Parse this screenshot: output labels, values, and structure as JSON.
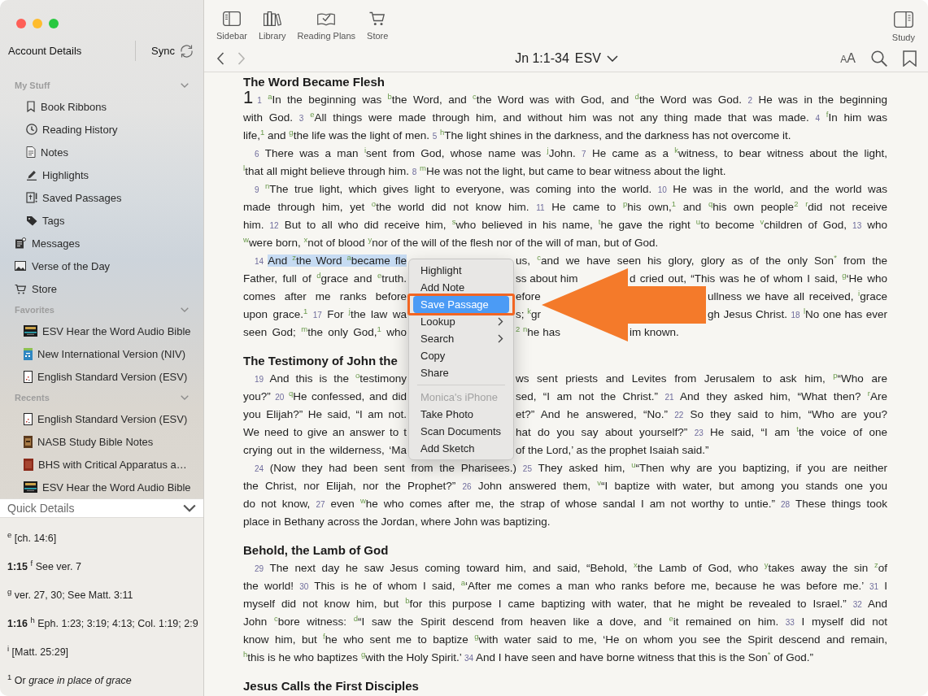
{
  "sidebar": {
    "account": "Account Details",
    "sync": "Sync",
    "groups": [
      {
        "kind": "section",
        "title": "My Stuff",
        "expanded": true,
        "children": [
          {
            "label": "Book Ribbons",
            "selected": false
          },
          {
            "label": "Reading History",
            "selected": false
          },
          {
            "label": "Notes",
            "selected": false
          },
          {
            "label": "Highlights",
            "selected": false
          },
          {
            "label": "Saved Passages",
            "selected": false
          },
          {
            "label": "Tags",
            "selected": false
          }
        ]
      },
      {
        "kind": "item",
        "label": "Messages",
        "selected": false
      },
      {
        "kind": "item",
        "label": "Verse of the Day",
        "selected": false
      },
      {
        "kind": "item",
        "label": "Store",
        "selected": false
      },
      {
        "kind": "section",
        "title": "Favorites",
        "expanded": true,
        "children": [
          {
            "label": "ESV Hear the Word Audio Bible",
            "selected": false
          },
          {
            "label": "New International Version (NIV)",
            "selected": false
          },
          {
            "label": "English Standard Version (ESV)",
            "selected": false
          }
        ]
      },
      {
        "kind": "section",
        "title": "Recents",
        "expanded": true,
        "children": [
          {
            "label": "English Standard Version (ESV)",
            "selected": false
          },
          {
            "label": "NASB Study Bible Notes",
            "selected": false
          },
          {
            "label": "BHS with Critical Apparatus a…",
            "selected": false
          },
          {
            "label": "ESV Hear the Word Audio Bible",
            "selected": false
          }
        ]
      }
    ]
  },
  "quick_details": {
    "title": "Quick Details",
    "expanded": true,
    "notes": [
      "$^{e}$ [ch. 14:6]",
      "**1:15** $^{f}$ See ver. 7",
      "$^{g}$ ver. 27, 30; See Matt. 3:11",
      "**1:16** $^{h}$ Eph. 1:23; 3:19; 4:13; Col. 1:19; 2:9",
      "$^{i}$ [Matt. 25:29]",
      "$^{1}$ Or *grace in place of grace*"
    ]
  },
  "toolbar": {
    "buttons": [
      {
        "label": "Sidebar"
      },
      {
        "label": "Library"
      },
      {
        "label": "Reading Plans"
      },
      {
        "label": "Store"
      }
    ],
    "study": {
      "label": "Study"
    }
  },
  "navigation": {
    "back": {
      "disabled": false
    },
    "forward": {
      "disabled": true
    },
    "reference": "Jn 1:1-34",
    "version": "ESV",
    "text_size": [
      "A",
      "A"
    ]
  },
  "reader": {
    "sections": [
      {
        "heading": "The Word Became Flesh",
        "paragraphs": [
          {
            "chapter": "1",
            "lines": [
              [
                [
                  {
                    "text": "$_{1}$ $^{a}$In the beginning was $^{b}$the Word, and $^{c}$the Word was with God, and $^{d}$the Word was God. $_{2}$ He was in the beginning",
                    "selected": false
                  }
                ]
              ],
              [
                [
                  {
                    "text": "with God. $_{3}$ $^{e}$All things were made through him, and without him was not any thing made that was made. $_{4}$ $^{f}$In him was",
                    "selected": false
                  }
                ]
              ],
              [
                [
                  {
                    "text": "life,$^{1}$ and $^{g}$the life was the light of men. $_{5}$ $^{h}$The light shines in the darkness, and the darkness has not overcome it.",
                    "selected": false
                  }
                ]
              ]
            ]
          },
          {
            "lines": [
              [
                [
                  {
                    "text": "$_{6}$ There was a man $^{i}$sent from God, whose name was $^{j}$John. $_{7}$ He came as a $^{k}$witness, to bear witness about the light,",
                    "selected": false
                  }
                ]
              ],
              [
                [
                  {
                    "text": "$^{l}$that all might believe through him. $_{8}$ $^{m}$He was not the light, but came to bear witness about the light.",
                    "selected": false
                  }
                ]
              ]
            ]
          },
          {
            "lines": [
              [
                [
                  {
                    "text": "$_{9}$ $^{n}$The true light, which gives light to everyone, was coming into the world. $_{10}$ He was in the world, and the world was",
                    "selected": false
                  }
                ]
              ],
              [
                [
                  {
                    "text": "made through him, yet $^{o}$the world did not know him. $_{11}$ He came to $^{p}$his own,$^{1}$ and $^{q}$his own people$^{2}$ $^{r}$did not receive",
                    "selected": false
                  }
                ]
              ],
              [
                [
                  {
                    "text": "him. $_{12}$ But to all who did receive him, $^{s}$who believed in his name, $^{t}$he gave the right $^{u}$to become $^{v}$children of God, $_{13}$ who",
                    "selected": false
                  }
                ]
              ],
              [
                [
                  {
                    "text": "$^{w}$were born, $^{x}$not of blood $^{y}$nor of the will of the flesh nor of the will of man, but of God.",
                    "selected": false
                  }
                ]
              ]
            ]
          },
          {
            "lines": [
              [
                [
                  {
                    "text": "$_{14}$ ",
                    "selected": false
                  },
                  {
                    "text": "And $^{z}$the Word $^{a}$became fle",
                    "selected": true
                  }
                ],
                [
                  {
                    "text": "us, $^{c}$and we have seen his glory, glory as of the only Son$^{*}$ from the",
                    "selected": false
                  }
                ]
              ],
              [
                [
                  {
                    "text": "Father, full of $^{d}$grace and $^{e}$truth.",
                    "selected": false
                  }
                ],
                [
                  {
                    "text": "ss about him",
                    "selected": false
                  }
                ],
                [
                  {
                    "text": "d cried out, “This was he of whom I said, $^{g}$‘He who",
                    "selected": false
                  }
                ]
              ],
              [
                [
                  {
                    "text": "comes after me ranks before",
                    "selected": false
                  }
                ],
                [
                  {
                    "text": "efore",
                    "selected": false
                  }
                ],
                [
                  {
                    "text": "ullness we have all received, $^{i}$grace",
                    "selected": false
                  }
                ]
              ],
              [
                [
                  {
                    "text": "upon grace.$^{1}$ $_{17}$ For $^{j}$the law wa",
                    "selected": false
                  }
                ],
                [
                  {
                    "text": "s; $^{k}$gr",
                    "selected": false
                  }
                ],
                [
                  {
                    "text": "gh Jesus Christ. $_{18}$ $^{l}$No one has ever",
                    "selected": false
                  }
                ]
              ],
              [
                [
                  {
                    "text": "seen God; $^{m}$the only God,$^{1}$ who",
                    "selected": false
                  }
                ],
                [
                  {
                    "text": "$^{2}$ $^{n}$he has",
                    "selected": false
                  }
                ],
                [
                  {
                    "text": "im known.",
                    "selected": false
                  }
                ]
              ]
            ]
          }
        ]
      },
      {
        "heading": "The Testimony of John the",
        "paragraphs": [
          {
            "lines": [
              [
                [
                  {
                    "text": "$_{19}$ And this is the $^{o}$testimony",
                    "selected": false
                  }
                ],
                [
                  {
                    "text": "ws sent priests and Levites from Jerusalem to ask him, $^{p}$“Who are",
                    "selected": false
                  }
                ]
              ],
              [
                [
                  {
                    "text": "you?” $_{20}$ $^{q}$He confessed, and did",
                    "selected": false
                  }
                ],
                [
                  {
                    "text": "sed, “I am not the Christ.” $_{21}$ And they asked him, “What then? $^{r}$Are",
                    "selected": false
                  }
                ]
              ],
              [
                [
                  {
                    "text": "you Elijah?” He said, “I am not.",
                    "selected": false
                  }
                ],
                [
                  {
                    "text": "et?” And he answered, “No.” $_{22}$ So they said to him, “Who are you?",
                    "selected": false
                  }
                ]
              ],
              [
                [
                  {
                    "text": "We need to give an answer to t",
                    "selected": false
                  }
                ],
                [
                  {
                    "text": "hat do you say about yourself?” $_{23}$ He said, “I am $^{t}$the voice of one",
                    "selected": false
                  }
                ]
              ],
              [
                [
                  {
                    "text": "crying out in the wilderness, ‘Ma",
                    "selected": false
                  }
                ],
                [
                  {
                    "text": "of the Lord,’ as the prophet Isaiah said.”",
                    "selected": false
                  }
                ]
              ]
            ]
          },
          {
            "lines": [
              [
                [
                  {
                    "text": "$_{24}$ (Now they had been sent from the Pharisees.) $_{25}$ They asked him, $^{u}$“Then why are you baptizing, if you are neither",
                    "selected": false
                  }
                ]
              ],
              [
                [
                  {
                    "text": "the Christ, nor Elijah, nor the Prophet?” $_{26}$ John answered them, $^{v}$“I baptize with water, but among you stands one you",
                    "selected": false
                  }
                ]
              ],
              [
                [
                  {
                    "text": "do not know, $_{27}$ even $^{w}$he who comes after me, the strap of whose sandal I am not worthy to untie.” $_{28}$ These things took",
                    "selected": false
                  }
                ]
              ],
              [
                [
                  {
                    "text": "place in Bethany across the Jordan, where John was baptizing.",
                    "selected": false
                  }
                ]
              ]
            ]
          }
        ]
      },
      {
        "heading": "Behold, the Lamb of God",
        "paragraphs": [
          {
            "lines": [
              [
                [
                  {
                    "text": "$_{29}$ The next day he saw Jesus coming toward him, and said, “Behold, $^{x}$the Lamb of God, who $^{y}$takes away the sin $^{z}$of",
                    "selected": false
                  }
                ]
              ],
              [
                [
                  {
                    "text": "the world! $_{30}$ This is he of whom I said, $^{a}$‘After me comes a man who ranks before me, because he was before me.’ $_{31}$ I",
                    "selected": false
                  }
                ]
              ],
              [
                [
                  {
                    "text": "myself did not know him, but $^{b}$for this purpose I came baptizing with water, that he might be revealed to Israel.” $_{32}$ And",
                    "selected": false
                  }
                ]
              ],
              [
                [
                  {
                    "text": "John $^{c}$bore witness: $^{d}$“I saw the Spirit descend from heaven like a dove, and $^{e}$it remained on him. $_{33}$ I myself did not",
                    "selected": false
                  }
                ]
              ],
              [
                [
                  {
                    "text": "know him, but $^{f}$he who sent me to baptize $^{g}$with water said to me, ‘He on whom you see the Spirit descend and remain,",
                    "selected": false
                  }
                ]
              ],
              [
                [
                  {
                    "text": "$^{h}$this is he who baptizes $^{g}$with the Holy Spirit.’ $_{34}$ And I have seen and have borne witness that this is the Son$^{*}$ of God.”",
                    "selected": false
                  }
                ]
              ]
            ]
          }
        ]
      },
      {
        "heading": "Jesus Calls the First Disciples"
      }
    ]
  },
  "context_menu": {
    "items": [
      {
        "kind": "item",
        "label": "Highlight",
        "selected": false,
        "disabled": false,
        "submenu": false
      },
      {
        "kind": "item",
        "label": "Add Note",
        "selected": false,
        "disabled": false,
        "submenu": false
      },
      {
        "kind": "item",
        "label": "Save Passage",
        "selected": true,
        "disabled": false,
        "submenu": false
      },
      {
        "kind": "item",
        "label": "Lookup",
        "selected": false,
        "disabled": false,
        "submenu": true
      },
      {
        "kind": "item",
        "label": "Search",
        "selected": false,
        "disabled": false,
        "submenu": true
      },
      {
        "kind": "item",
        "label": "Copy",
        "selected": false,
        "disabled": false,
        "submenu": false
      },
      {
        "kind": "item",
        "label": "Share",
        "selected": false,
        "disabled": false,
        "submenu": false
      },
      {
        "kind": "separator"
      },
      {
        "kind": "item",
        "label": "Monica's iPhone",
        "selected": false,
        "disabled": true,
        "submenu": false
      },
      {
        "kind": "item",
        "label": "Take Photo",
        "selected": false,
        "disabled": false,
        "submenu": false
      },
      {
        "kind": "item",
        "label": "Scan Documents",
        "selected": false,
        "disabled": false,
        "submenu": false
      },
      {
        "kind": "item",
        "label": "Add Sketch",
        "selected": false,
        "disabled": false,
        "submenu": false
      }
    ]
  }
}
